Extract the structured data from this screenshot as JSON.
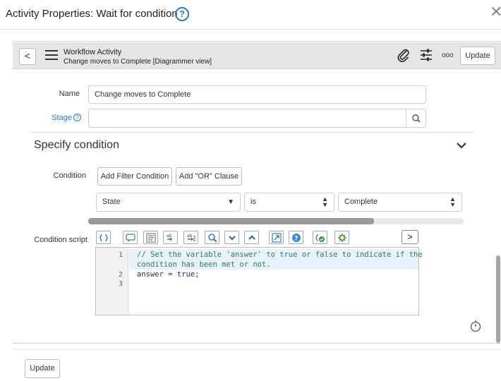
{
  "dialog": {
    "title": "Activity Properties: Wait for condition",
    "help_glyph": "?",
    "close_glyph": "✕"
  },
  "form_header": {
    "back_glyph": "<",
    "record_type": "Workflow Activity",
    "record_name": "Change moves to Complete [Diagrammer view]",
    "update_label": "Update",
    "more_glyph": "ooo",
    "icons": [
      "attachment-icon",
      "settings-sliders-icon",
      "more-options-icon"
    ]
  },
  "fields": {
    "name_label": "Name",
    "name_value": "Change moves to Complete",
    "stage_label": "Stage",
    "stage_help": "?",
    "stage_value": ""
  },
  "section": {
    "title": "Specify condition"
  },
  "condition": {
    "label": "Condition",
    "add_filter_label": "Add Filter Condition",
    "add_or_label": "Add \"OR\" Clause",
    "field_select": "State",
    "operator_select": "is",
    "value_select": "Complete"
  },
  "script": {
    "label": "Condition script",
    "line_numbers": [
      "1",
      "",
      "2",
      "3"
    ],
    "line1a": "// Set the variable 'answer' to true or false to indicate if the",
    "line1b": "condition has been met or not.",
    "line2_var": "answer = ",
    "line2_kw": "true",
    "line2_end": ";",
    "toolbar_icons": [
      "format-code-icon",
      "comment-icon",
      "script-list-icon",
      "replace-icon",
      "replace-all-icon",
      "search-icon",
      "find-next-icon",
      "find-previous-icon",
      "fullscreen-icon",
      "help-icon",
      "syntax-check-icon",
      "debug-icon"
    ],
    "next_glyph": ">"
  },
  "footer": {
    "update_label": "Update"
  },
  "colors": {
    "accent": "#2a7ac7",
    "header_bg": "#e4e6e8",
    "code_comment": "#2e7d4f",
    "code_keyword": "#1a2fa8"
  }
}
